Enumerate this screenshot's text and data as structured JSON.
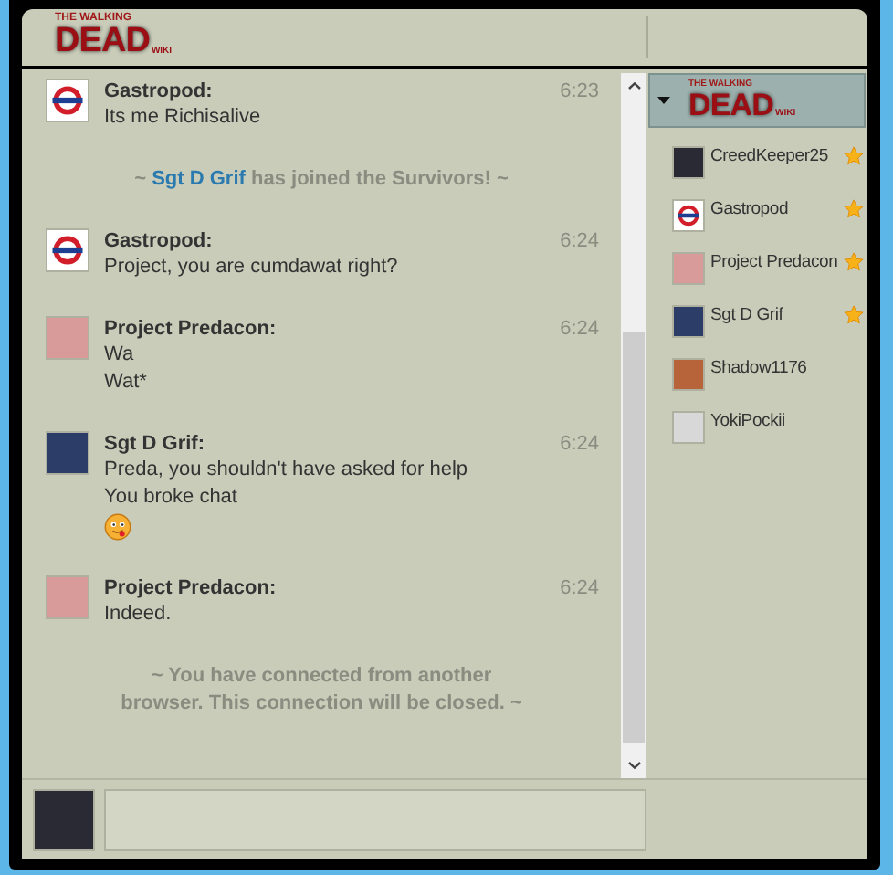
{
  "header": {
    "logo": {
      "top": "THE WALKING",
      "main": "DEAD",
      "suffix": "WIKI"
    }
  },
  "messages": [
    {
      "kind": "message",
      "avatar": {
        "kind": "roundel"
      },
      "name": "Gastropod:",
      "time": "6:23",
      "lines": [
        {
          "kind": "text",
          "text": "Its me Richisalive"
        }
      ]
    },
    {
      "kind": "system",
      "parts": [
        {
          "kind": "plain",
          "text": "~"
        },
        {
          "kind": "link",
          "text": "Sgt D Grif"
        },
        {
          "kind": "plain",
          "text": "has joined the Survivors! ~"
        }
      ]
    },
    {
      "kind": "message",
      "avatar": {
        "kind": "roundel"
      },
      "name": "Gastropod:",
      "time": "6:24",
      "lines": [
        {
          "kind": "text",
          "text": "Project, you are cumdawat right?"
        }
      ]
    },
    {
      "kind": "message",
      "avatar": {
        "kind": "pink"
      },
      "name": "Project Predacon:",
      "time": "6:24",
      "lines": [
        {
          "kind": "text",
          "text": "Wa"
        },
        {
          "kind": "text",
          "text": "Wat*"
        }
      ]
    },
    {
      "kind": "message",
      "avatar": {
        "kind": "blue"
      },
      "name": "Sgt D Grif:",
      "time": "6:24",
      "lines": [
        {
          "kind": "text",
          "text": "Preda, you shouldn't have asked for help"
        },
        {
          "kind": "text",
          "text": "You broke chat"
        },
        {
          "kind": "emoticon"
        }
      ]
    },
    {
      "kind": "message",
      "avatar": {
        "kind": "pink"
      },
      "name": "Project Predacon:",
      "time": "6:24",
      "lines": [
        {
          "kind": "text",
          "text": "Indeed."
        }
      ]
    },
    {
      "kind": "system",
      "parts": [
        {
          "kind": "plain",
          "text": "~ You have connected from another browser. This connection will be closed. ~"
        }
      ]
    }
  ],
  "userlist": {
    "logo": {
      "top": "THE WALKING",
      "main": "DEAD",
      "suffix": "WIKI"
    },
    "expanded": true,
    "users": [
      {
        "name": "CreedKeeper25",
        "avatar": {
          "kind": "dark"
        },
        "starred": true
      },
      {
        "name": "Gastropod",
        "avatar": {
          "kind": "roundel"
        },
        "starred": true
      },
      {
        "name": "Project Predacon",
        "avatar": {
          "kind": "pink"
        },
        "starred": true
      },
      {
        "name": "Sgt D Grif",
        "avatar": {
          "kind": "blue"
        },
        "starred": true
      },
      {
        "name": "Shadow1176",
        "avatar": {
          "kind": "orange"
        },
        "starred": false
      },
      {
        "name": "YokiPockii",
        "avatar": {
          "kind": "grey"
        },
        "starred": false
      }
    ]
  },
  "composer": {
    "avatar": {
      "kind": "dark"
    }
  }
}
